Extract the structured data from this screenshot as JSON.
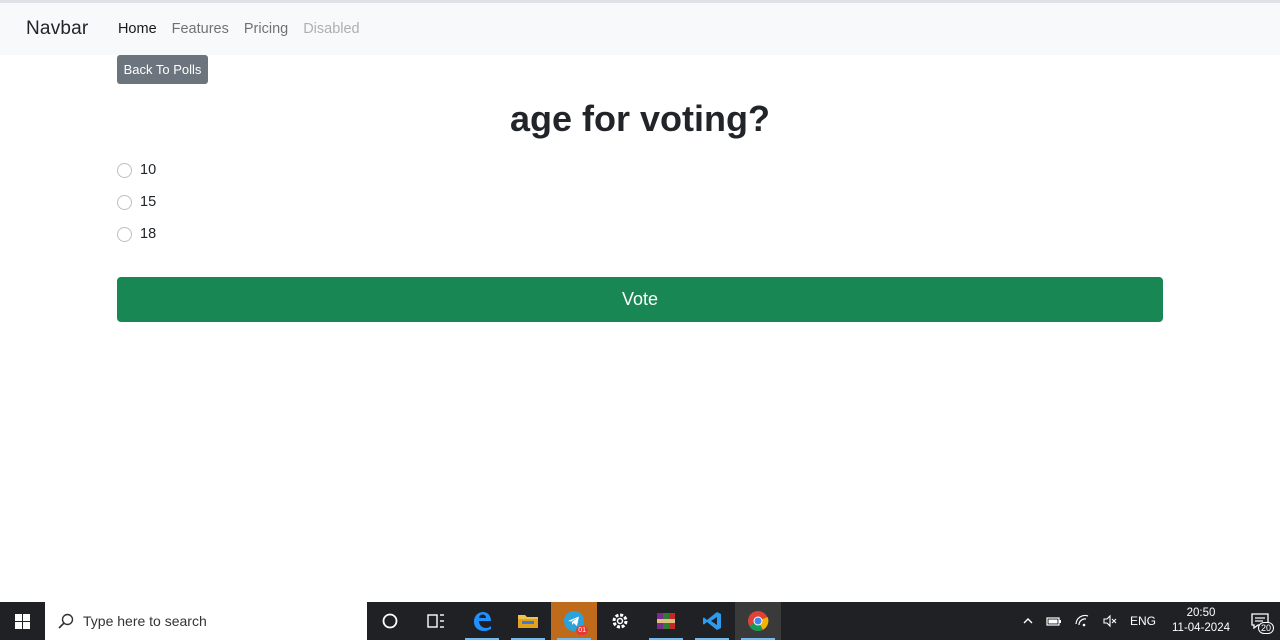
{
  "navbar": {
    "brand": "Navbar",
    "links": [
      {
        "label": "Home",
        "state": "active"
      },
      {
        "label": "Features",
        "state": "normal"
      },
      {
        "label": "Pricing",
        "state": "normal"
      },
      {
        "label": "Disabled",
        "state": "disabled"
      }
    ]
  },
  "back_button": "Back To Polls",
  "poll": {
    "question": "age for voting?",
    "options": [
      "10",
      "15",
      "18"
    ],
    "vote_label": "Vote"
  },
  "taskbar": {
    "search_placeholder": "Type here to search",
    "icons": [
      "cortana-icon",
      "task-view-icon",
      "edge-icon",
      "file-explorer-icon",
      "telegram-icon",
      "settings-icon",
      "winrar-icon",
      "vscode-icon",
      "chrome-icon"
    ],
    "telegram_badge": "01",
    "language": "ENG",
    "time": "20:50",
    "date": "11-04-2024",
    "notification_count": "20"
  },
  "colors": {
    "navbar_bg": "#f8f9fa",
    "secondary": "#6c757d",
    "success": "#198754",
    "taskbar_bg": "#202124"
  }
}
